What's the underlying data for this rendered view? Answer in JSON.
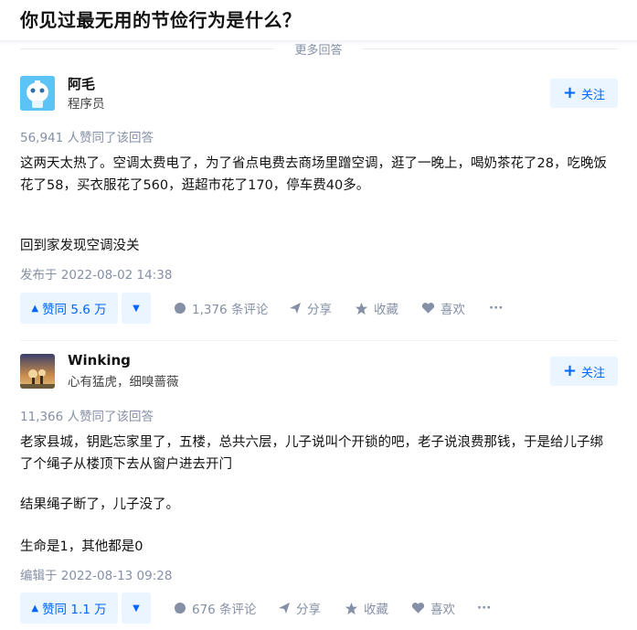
{
  "question": {
    "title": "你见过最无用的节俭行为是什么？",
    "more_answers": "更多回答"
  },
  "answers": [
    {
      "author": {
        "name": "阿毛",
        "bio": "程序员"
      },
      "follow_label": "关注",
      "vote_text": "56,941 人赞同了该回答",
      "paragraphs": [
        "这两天太热了。空调太费电了，为了省点电费去商场里蹭空调，逛了一晚上，喝奶茶花了28，吃晚饭花了58，买衣服花了560，逛超市花了170，停车费40多。",
        "回到家发现空调没关"
      ],
      "time": "发布于 2022-08-02 14:38",
      "actions": {
        "upvote": "赞同 5.6 万",
        "comments": "1,376 条评论",
        "share": "分享",
        "favorite": "收藏",
        "like": "喜欢",
        "more": "···"
      }
    },
    {
      "author": {
        "name": "Winking",
        "bio": "心有猛虎，细嗅蔷薇"
      },
      "follow_label": "关注",
      "vote_text": "11,366 人赞同了该回答",
      "paragraphs": [
        "老家县城，钥匙忘家里了，五楼，总共六层，儿子说叫个开锁的吧，老子说浪费那钱，于是给儿子绑了个绳子从楼顶下去从窗户进去开门",
        "结果绳子断了，儿子没了。",
        "生命是1，其他都是0"
      ],
      "time": "编辑于 2022-08-13 09:28",
      "actions": {
        "upvote": "赞同 1.1 万",
        "comments": "676 条评论",
        "share": "分享",
        "favorite": "收藏",
        "like": "喜欢",
        "more": "···"
      }
    }
  ]
}
